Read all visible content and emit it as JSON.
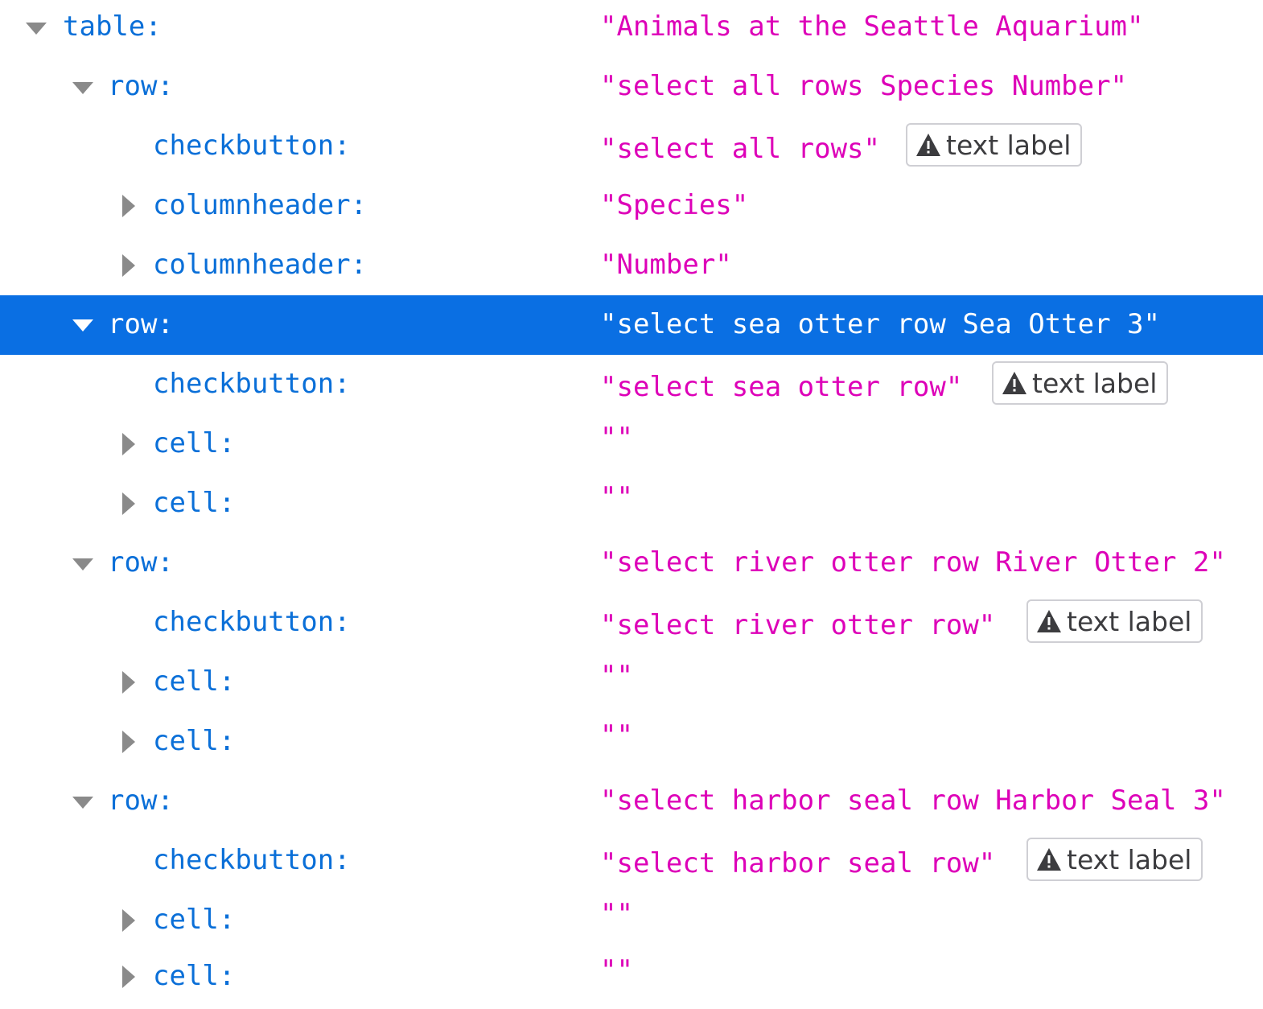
{
  "colors": {
    "role": "#0a6fd8",
    "name": "#dd00b8",
    "selected_background": "#0a6fe3",
    "badge_border": "#cfcfd4",
    "twisty": "#8a8a8a"
  },
  "badge_icon": "warning-icon",
  "selected_row": 5,
  "nodes": [
    {
      "role": "table:",
      "name": "\"Animals at the Seattle Aquarium\"",
      "twisty": "expanded"
    },
    {
      "role": "row:",
      "name": "\"select all rows Species Number\"",
      "twisty": "expanded"
    },
    {
      "role": "checkbutton:",
      "name": "\"select all rows\"",
      "badge": "text label"
    },
    {
      "role": "columnheader:",
      "name": "\"Species\"",
      "twisty": "collapsed"
    },
    {
      "role": "columnheader:",
      "name": "\"Number\"",
      "twisty": "collapsed"
    },
    {
      "role": "row:",
      "name": "\"select sea otter row Sea Otter 3\"",
      "twisty": "expanded"
    },
    {
      "role": "checkbutton:",
      "name": "\"select sea otter row\"",
      "badge": "text label"
    },
    {
      "role": "cell:",
      "name": "\"\"",
      "twisty": "collapsed"
    },
    {
      "role": "cell:",
      "name": "\"\"",
      "twisty": "collapsed"
    },
    {
      "role": "row:",
      "name": "\"select river otter row River Otter 2\"",
      "twisty": "expanded"
    },
    {
      "role": "checkbutton:",
      "name": "\"select river otter row\"",
      "badge": "text label"
    },
    {
      "role": "cell:",
      "name": "\"\"",
      "twisty": "collapsed"
    },
    {
      "role": "cell:",
      "name": "\"\"",
      "twisty": "collapsed"
    },
    {
      "role": "row:",
      "name": "\"select harbor seal row Harbor Seal 3\"",
      "twisty": "expanded"
    },
    {
      "role": "checkbutton:",
      "name": "\"select harbor seal row\"",
      "badge": "text label"
    },
    {
      "role": "cell:",
      "name": "\"\"",
      "twisty": "collapsed"
    },
    {
      "role": "cell:",
      "name": "\"\"",
      "twisty": "collapsed"
    }
  ]
}
